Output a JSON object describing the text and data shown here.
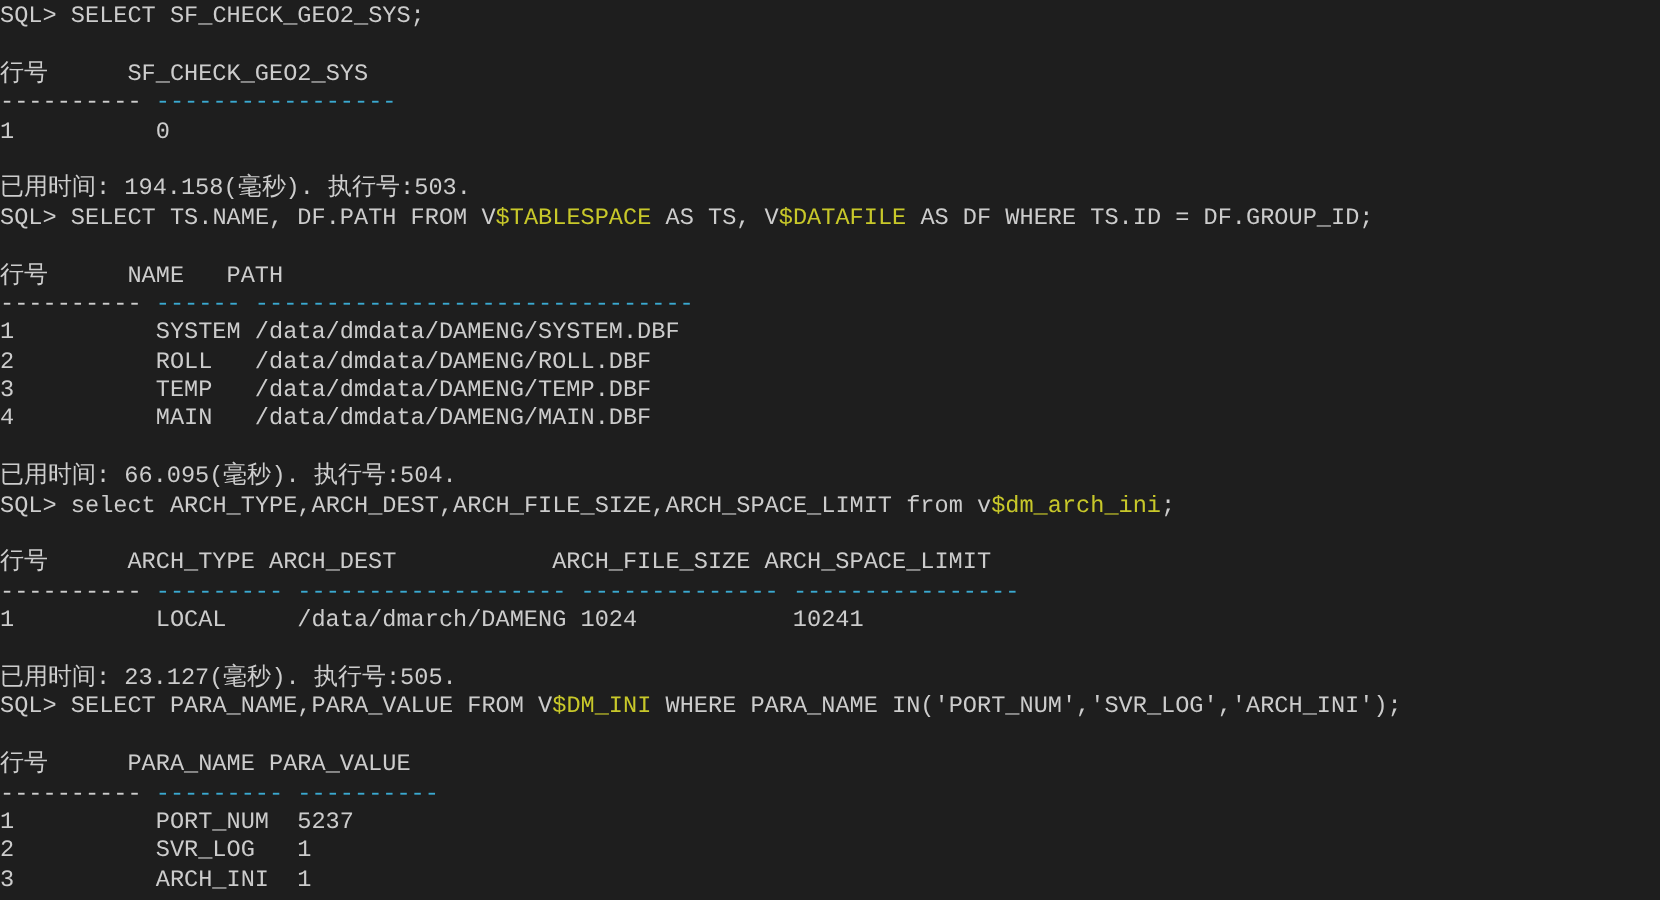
{
  "lines": [
    {
      "kind": "command",
      "prompt": "SQL>",
      "segments": [
        {
          "text": " SELECT SF_CHECK_GEO2_SYS;",
          "highlight": false
        }
      ]
    },
    {
      "kind": "blank"
    },
    {
      "kind": "header",
      "label": "行号",
      "text": "SF_CHECK_GEO2_SYS"
    },
    {
      "kind": "rule",
      "segments": [
        {
          "text": "----------",
          "highlight": false
        },
        {
          "text": " -----------------",
          "highlight": true
        }
      ]
    },
    {
      "kind": "row",
      "number": "1",
      "text": "0"
    },
    {
      "kind": "blank"
    },
    {
      "kind": "elapsed",
      "text": "已用时间: 194.158(毫秒). 执行号:503."
    },
    {
      "kind": "command",
      "prompt": "SQL>",
      "segments": [
        {
          "text": " SELECT TS.NAME, DF.PATH FROM V",
          "highlight": false
        },
        {
          "text": "$TABLESPACE",
          "highlight": true
        },
        {
          "text": " AS TS, V",
          "highlight": false
        },
        {
          "text": "$DATAFILE",
          "highlight": true
        },
        {
          "text": " AS DF WHERE TS.ID = DF.GROUP_ID;",
          "highlight": false
        }
      ]
    },
    {
      "kind": "blank"
    },
    {
      "kind": "header",
      "label": "行号",
      "text": "NAME   PATH"
    },
    {
      "kind": "rule",
      "segments": [
        {
          "text": "----------",
          "highlight": false
        },
        {
          "text": " ------ -------------------------------",
          "highlight": true
        }
      ]
    },
    {
      "kind": "row",
      "number": "1",
      "text": "SYSTEM /data/dmdata/DAMENG/SYSTEM.DBF"
    },
    {
      "kind": "row",
      "number": "2",
      "text": "ROLL   /data/dmdata/DAMENG/ROLL.DBF"
    },
    {
      "kind": "row",
      "number": "3",
      "text": "TEMP   /data/dmdata/DAMENG/TEMP.DBF"
    },
    {
      "kind": "row",
      "number": "4",
      "text": "MAIN   /data/dmdata/DAMENG/MAIN.DBF"
    },
    {
      "kind": "blank"
    },
    {
      "kind": "elapsed",
      "text": "已用时间: 66.095(毫秒). 执行号:504."
    },
    {
      "kind": "command",
      "prompt": "SQL>",
      "segments": [
        {
          "text": " select ARCH_TYPE,ARCH_DEST,ARCH_FILE_SIZE,ARCH_SPACE_LIMIT from v",
          "highlight": false
        },
        {
          "text": "$dm_arch_ini",
          "highlight": true
        },
        {
          "text": ";",
          "highlight": false
        }
      ]
    },
    {
      "kind": "blank"
    },
    {
      "kind": "header",
      "label": "行号",
      "text": "ARCH_TYPE ARCH_DEST           ARCH_FILE_SIZE ARCH_SPACE_LIMIT"
    },
    {
      "kind": "rule",
      "segments": [
        {
          "text": "----------",
          "highlight": false
        },
        {
          "text": " --------- ------------------- -------------- ----------------",
          "highlight": true
        }
      ]
    },
    {
      "kind": "row",
      "number": "1",
      "text": "LOCAL     /data/dmarch/DAMENG 1024           10241"
    },
    {
      "kind": "blank"
    },
    {
      "kind": "elapsed",
      "text": "已用时间: 23.127(毫秒). 执行号:505."
    },
    {
      "kind": "command",
      "prompt": "SQL>",
      "segments": [
        {
          "text": " SELECT PARA_NAME,PARA_VALUE FROM V",
          "highlight": false
        },
        {
          "text": "$DM_INI",
          "highlight": true
        },
        {
          "text": " WHERE PARA_NAME IN('PORT_NUM','SVR_LOG','ARCH_INI');",
          "highlight": false
        }
      ]
    },
    {
      "kind": "blank"
    },
    {
      "kind": "header",
      "label": "行号",
      "text": "PARA_NAME PARA_VALUE"
    },
    {
      "kind": "rule",
      "segments": [
        {
          "text": "----------",
          "highlight": false
        },
        {
          "text": " --------- ----------",
          "highlight": true
        }
      ]
    },
    {
      "kind": "row",
      "number": "1",
      "text": "PORT_NUM  5237"
    },
    {
      "kind": "row",
      "number": "2",
      "text": "SVR_LOG   1"
    },
    {
      "kind": "row",
      "number": "3",
      "text": "ARCH_INI  1"
    }
  ]
}
